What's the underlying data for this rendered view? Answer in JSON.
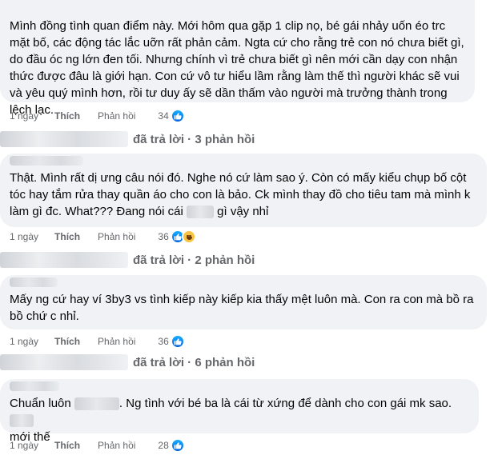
{
  "comments": [
    {
      "text": "Mình đồng tình quan điểm này. Mới hôm qua gặp 1 clip nọ, bé gái nhảy uốn éo trc mặt bố, các động tác lắc uỡn rất phản cảm. Ngta cứ cho rằng trẻ con nó chưa biết gì, do đầu óc ng lớn đen tối. Nhưng chính vì trẻ chưa biết gì nên mới cần dạy con nhận thức được đâu là giới hạn. Con cứ vô tư hiểu lầm rằng làm thế thì người khác sẽ vui và yêu quý mình hơn, rồi tư duy ấy sẽ dần thấm vào người mà trưởng thành trong lệch lạc.",
      "time": "1 ngày",
      "like_label": "Thích",
      "reply_label": "Phản hồi",
      "reaction_count": "34",
      "reactions": [
        "like-icon"
      ],
      "replies_text": "đã trả lời · 3 phản hồi"
    },
    {
      "text_part1": "Thật. Mình rất dị ưng câu nói đó. Nghe nó cứ làm sao ý. Còn có mấy kiểu chụp bố cột tóc hay tắm rửa thay quần áo cho con là bảo. Ck mình thay đồ cho tiêu tam mà mình k làm gì đc. What??? Đang nói cái",
      "text_part2": "gì vậy nhỉ",
      "time": "1 ngày",
      "like_label": "Thích",
      "reply_label": "Phản hồi",
      "reaction_count": "36",
      "reactions": [
        "like-icon",
        "haha-icon"
      ],
      "replies_text": "đã trả lời · 2 phản hồi"
    },
    {
      "text": "Mấy ng cứ hay ví 3by3 vs tình kiếp này kiếp kia thấy mệt luôn mà. Con ra con mà bồ ra bồ chứ c nhỉ.",
      "time": "1 ngày",
      "like_label": "Thích",
      "reply_label": "Phản hồi",
      "reaction_count": "36",
      "reactions": [
        "like-icon"
      ],
      "replies_text": "đã trả lời · 6 phản hồi"
    },
    {
      "text_part1": "Chuẩn luôn",
      "text_part2": ". Ng tình với bé ba là cái từ xứng để dành cho con gái mk sao.",
      "text_part3": "mới thế",
      "time": "1 ngày",
      "like_label": "Thích",
      "reply_label": "Phản hồi",
      "reaction_count": "28",
      "reactions": [
        "like-icon"
      ]
    }
  ],
  "colors": {
    "bubble": "#f0f2f5",
    "meta": "#65676b",
    "text": "#050505",
    "like": "#0866ff",
    "haha": "#f7c444"
  }
}
